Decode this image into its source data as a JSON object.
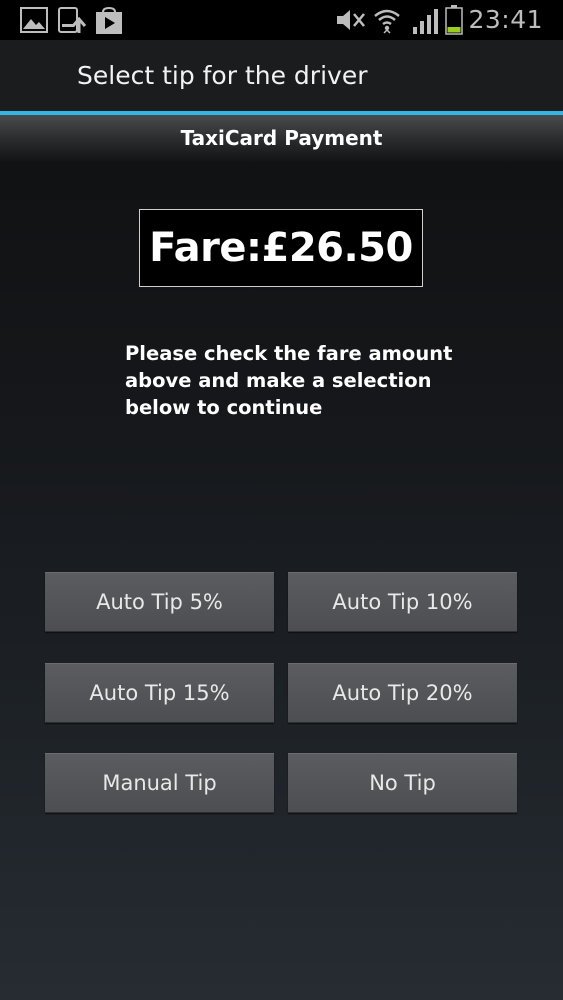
{
  "status_bar": {
    "icons": [
      "gallery-icon",
      "upload-icon",
      "play-store-icon",
      "mute-icon",
      "wifi-icon",
      "signal-icon",
      "battery-icon"
    ],
    "time": "23:41"
  },
  "title_bar": {
    "title": "Select tip for the driver"
  },
  "sub_header": {
    "title": "TaxiCard Payment"
  },
  "fare": {
    "text": "Fare:£26.50"
  },
  "instructions": {
    "line1": "Please check the fare amount",
    "line2": "above and make a selection",
    "line3": "below to continue"
  },
  "buttons": {
    "auto_tip_5": "Auto Tip 5%",
    "auto_tip_10": "Auto Tip 10%",
    "auto_tip_15": "Auto Tip 15%",
    "auto_tip_20": "Auto Tip 20%",
    "manual_tip": "Manual Tip",
    "no_tip": "No Tip"
  },
  "colors": {
    "accent": "#35b5e5",
    "button": "#505256",
    "battery_level": "#9ccc1e"
  }
}
